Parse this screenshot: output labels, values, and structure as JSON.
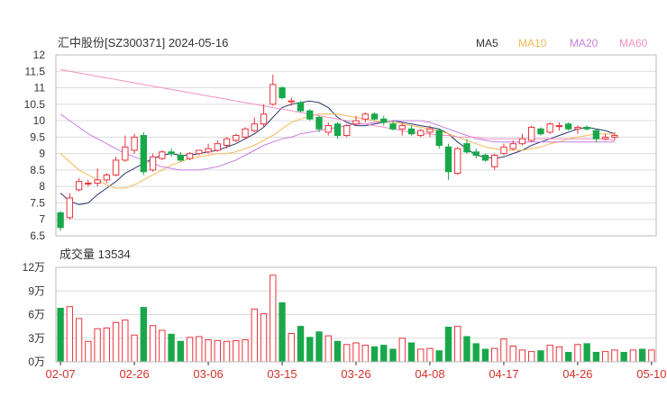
{
  "header": {
    "title": "汇中股份[SZ300371] 2024-05-16",
    "volume_label": "成交量 13534"
  },
  "legend": [
    {
      "name": "MA5",
      "color": "#2a3a6e"
    },
    {
      "name": "MA10",
      "color": "#f5b955"
    },
    {
      "name": "MA20",
      "color": "#c77fe0"
    },
    {
      "name": "MA60",
      "color": "#f490c0"
    }
  ],
  "colors": {
    "up": "#e8343c",
    "down": "#18a84a",
    "grid": "#dcdcdc",
    "axis": "#333333",
    "xtick": "#d4322c"
  },
  "chart_data": [
    {
      "type": "candlestick",
      "title": "汇中股份[SZ300371] 2024-05-16",
      "ylim": [
        6.5,
        12
      ],
      "yticks": [
        6.5,
        7,
        7.5,
        8,
        8.5,
        9,
        9.5,
        10,
        10.5,
        11,
        11.5,
        12
      ],
      "ytick_labels": [
        "6.5",
        "7",
        "7.5",
        "8",
        "8.5",
        "9",
        "9.5",
        "10",
        "10.5",
        "11",
        "11.5",
        "12"
      ],
      "x": [
        "02-07",
        "02-08",
        "02-19",
        "02-20",
        "02-21",
        "02-22",
        "02-23",
        "02-26",
        "02-27",
        "02-28",
        "02-29",
        "03-01",
        "03-04",
        "03-05",
        "03-06",
        "03-07",
        "03-08",
        "03-11",
        "03-12",
        "03-13",
        "03-14",
        "03-15",
        "03-18",
        "03-19",
        "03-20",
        "03-21",
        "03-22",
        "03-25",
        "03-26",
        "03-27",
        "03-28",
        "03-29",
        "04-01",
        "04-02",
        "04-03",
        "04-08",
        "04-09",
        "04-10",
        "04-11",
        "04-12",
        "04-15",
        "04-16",
        "04-17",
        "04-18",
        "04-19",
        "04-22",
        "04-23",
        "04-24",
        "04-25",
        "04-26",
        "04-29",
        "04-30",
        "05-06",
        "05-07",
        "05-08",
        "05-09",
        "05-10",
        "05-13",
        "05-14",
        "05-15",
        "05-16"
      ],
      "xtick_labels": [
        {
          "index": 0,
          "label": "02-07"
        },
        {
          "index": 8,
          "label": "02-26"
        },
        {
          "index": 16,
          "label": "03-06"
        },
        {
          "index": 24,
          "label": "03-15"
        },
        {
          "index": 32,
          "label": "03-26"
        },
        {
          "index": 40,
          "label": "04-08"
        },
        {
          "index": 48,
          "label": "04-17"
        },
        {
          "index": 56,
          "label": "04-26"
        },
        {
          "index": 64,
          "label": "05-10"
        }
      ],
      "ohlc": [
        [
          7.2,
          7.25,
          6.65,
          6.75
        ],
        [
          7.05,
          7.8,
          7.0,
          7.65
        ],
        [
          7.9,
          8.25,
          7.85,
          8.15
        ],
        [
          8.1,
          8.2,
          8.0,
          8.1
        ],
        [
          8.1,
          8.55,
          8.0,
          8.2
        ],
        [
          8.2,
          8.4,
          8.1,
          8.35
        ],
        [
          8.35,
          8.9,
          8.3,
          8.8
        ],
        [
          8.8,
          9.55,
          8.75,
          9.2
        ],
        [
          9.1,
          9.6,
          9.0,
          9.5
        ],
        [
          9.55,
          9.65,
          8.35,
          8.45
        ],
        [
          8.5,
          9.0,
          8.45,
          8.9
        ],
        [
          8.85,
          9.1,
          8.8,
          9.05
        ],
        [
          9.05,
          9.15,
          8.9,
          9.0
        ],
        [
          8.95,
          9.05,
          8.75,
          8.8
        ],
        [
          8.85,
          9.05,
          8.8,
          9.0
        ],
        [
          9.0,
          9.1,
          8.95,
          9.1
        ],
        [
          9.05,
          9.3,
          9.0,
          9.15
        ],
        [
          9.1,
          9.4,
          9.05,
          9.3
        ],
        [
          9.25,
          9.5,
          9.15,
          9.45
        ],
        [
          9.4,
          9.6,
          9.35,
          9.55
        ],
        [
          9.5,
          9.8,
          9.45,
          9.75
        ],
        [
          9.7,
          10.1,
          9.65,
          9.9
        ],
        [
          9.9,
          10.5,
          9.8,
          10.2
        ],
        [
          10.5,
          11.4,
          10.45,
          11.1
        ],
        [
          11.0,
          11.05,
          10.65,
          10.7
        ],
        [
          10.6,
          10.7,
          10.45,
          10.6
        ],
        [
          10.55,
          10.6,
          10.25,
          10.3
        ],
        [
          10.3,
          10.35,
          10.0,
          10.05
        ],
        [
          10.1,
          10.15,
          9.65,
          9.75
        ],
        [
          9.65,
          9.95,
          9.55,
          9.85
        ],
        [
          9.9,
          9.95,
          9.45,
          9.55
        ],
        [
          9.55,
          9.9,
          9.5,
          9.85
        ],
        [
          9.9,
          10.15,
          9.85,
          10.0
        ],
        [
          10.05,
          10.25,
          9.95,
          10.2
        ],
        [
          10.2,
          10.25,
          10.0,
          10.05
        ],
        [
          10.05,
          10.15,
          9.85,
          9.95
        ],
        [
          9.9,
          10.0,
          9.7,
          9.75
        ],
        [
          9.75,
          9.95,
          9.55,
          9.85
        ],
        [
          9.75,
          9.85,
          9.55,
          9.6
        ],
        [
          9.55,
          9.75,
          9.5,
          9.7
        ],
        [
          9.65,
          9.85,
          9.5,
          9.75
        ],
        [
          9.7,
          9.75,
          9.15,
          9.25
        ],
        [
          9.2,
          9.3,
          8.2,
          8.45
        ],
        [
          8.4,
          9.2,
          8.35,
          9.15
        ],
        [
          9.3,
          9.45,
          9.0,
          9.05
        ],
        [
          9.05,
          9.15,
          8.85,
          8.95
        ],
        [
          8.95,
          9.0,
          8.75,
          8.8
        ],
        [
          8.6,
          9.0,
          8.5,
          8.95
        ],
        [
          9.0,
          9.3,
          8.95,
          9.2
        ],
        [
          9.15,
          9.4,
          9.1,
          9.3
        ],
        [
          9.3,
          9.6,
          9.25,
          9.45
        ],
        [
          9.4,
          9.85,
          9.35,
          9.8
        ],
        [
          9.75,
          9.8,
          9.55,
          9.6
        ],
        [
          9.65,
          9.95,
          9.6,
          9.9
        ],
        [
          9.85,
          9.95,
          9.7,
          9.85
        ],
        [
          9.9,
          9.95,
          9.7,
          9.75
        ],
        [
          9.75,
          9.85,
          9.6,
          9.8
        ],
        [
          9.8,
          9.85,
          9.7,
          9.75
        ],
        [
          9.7,
          9.75,
          9.35,
          9.45
        ],
        [
          9.45,
          9.6,
          9.4,
          9.5
        ],
        [
          9.5,
          9.65,
          9.4,
          9.55
        ]
      ],
      "series": [
        {
          "name": "MA5",
          "values": [
            7.8,
            7.55,
            7.45,
            7.5,
            7.75,
            7.95,
            8.15,
            8.4,
            8.55,
            8.7,
            8.85,
            8.95,
            9.0,
            8.95,
            8.95,
            9.0,
            9.05,
            9.1,
            9.2,
            9.3,
            9.45,
            9.6,
            9.8,
            10.1,
            10.4,
            10.5,
            10.55,
            10.6,
            10.55,
            10.4,
            10.1,
            9.95,
            9.85,
            9.85,
            9.9,
            9.95,
            10.0,
            9.95,
            9.9,
            9.85,
            9.8,
            9.75,
            9.6,
            9.35,
            9.15,
            8.95,
            8.9,
            8.85,
            8.9,
            9.0,
            9.1,
            9.25,
            9.35,
            9.45,
            9.55,
            9.65,
            9.75,
            9.8,
            9.75,
            9.7,
            9.6
          ]
        },
        {
          "name": "MA10",
          "values": [
            9.0,
            8.75,
            8.5,
            8.35,
            8.2,
            8.05,
            7.95,
            7.95,
            8.05,
            8.2,
            8.35,
            8.5,
            8.65,
            8.75,
            8.85,
            8.9,
            8.95,
            9.0,
            9.0,
            9.05,
            9.15,
            9.25,
            9.4,
            9.55,
            9.75,
            9.95,
            10.05,
            10.15,
            10.2,
            10.2,
            10.2,
            10.15,
            10.1,
            10.05,
            10.0,
            9.95,
            9.95,
            9.9,
            9.85,
            9.8,
            9.75,
            9.7,
            9.6,
            9.5,
            9.4,
            9.3,
            9.2,
            9.15,
            9.1,
            9.1,
            9.1,
            9.15,
            9.2,
            9.3,
            9.35,
            9.45,
            9.5,
            9.55,
            9.6,
            9.6,
            9.6
          ]
        },
        {
          "name": "MA20",
          "values": [
            10.2,
            10.0,
            9.8,
            9.6,
            9.45,
            9.3,
            9.15,
            9.0,
            8.9,
            8.8,
            8.7,
            8.6,
            8.55,
            8.5,
            8.5,
            8.5,
            8.55,
            8.6,
            8.7,
            8.8,
            8.95,
            9.1,
            9.25,
            9.35,
            9.45,
            9.5,
            9.6,
            9.65,
            9.7,
            9.75,
            9.8,
            9.85,
            9.9,
            9.9,
            9.95,
            9.95,
            10.0,
            10.0,
            10.0,
            10.0,
            9.95,
            9.85,
            9.75,
            9.65,
            9.55,
            9.45,
            9.4,
            9.35,
            9.35,
            9.35,
            9.35,
            9.35,
            9.35,
            9.35,
            9.35,
            9.35,
            9.35,
            9.35,
            9.35,
            9.35,
            9.35
          ]
        },
        {
          "name": "MA60",
          "values": [
            11.55,
            11.5,
            11.45,
            11.4,
            11.35,
            11.3,
            11.25,
            11.2,
            11.15,
            11.1,
            11.05,
            11.0,
            10.95,
            10.9,
            10.85,
            10.8,
            10.75,
            10.7,
            10.65,
            10.6,
            10.55,
            10.5,
            10.45,
            10.4,
            10.35,
            10.3,
            10.25,
            10.2,
            10.15,
            10.1,
            10.05,
            10.0,
            9.95,
            9.9,
            9.85,
            9.8,
            9.75,
            9.7,
            9.65,
            9.6,
            9.6,
            9.55,
            9.55,
            9.5,
            9.5,
            9.5,
            9.45,
            9.45,
            9.45,
            9.45,
            9.45,
            9.45,
            9.45,
            9.45,
            9.45,
            9.45,
            9.45,
            9.45,
            9.45,
            9.45,
            9.4
          ]
        }
      ]
    },
    {
      "type": "bar",
      "title": "成交量 13534",
      "ylim": [
        0,
        12
      ],
      "yticks": [
        0,
        3,
        6,
        9,
        12
      ],
      "ytick_labels": [
        "0万",
        "3万",
        "6万",
        "9万",
        "12万"
      ],
      "values": [
        6.8,
        7.0,
        5.5,
        2.6,
        4.2,
        4.3,
        5.0,
        5.3,
        3.4,
        6.9,
        4.6,
        4.0,
        3.5,
        2.6,
        3.1,
        3.2,
        2.8,
        2.7,
        2.6,
        2.7,
        2.8,
        6.7,
        6.1,
        11.0,
        7.5,
        3.6,
        4.5,
        3.1,
        3.8,
        3.3,
        2.6,
        2.2,
        2.4,
        2.1,
        1.9,
        2.1,
        1.6,
        3.0,
        2.4,
        1.6,
        1.7,
        1.4,
        4.4,
        4.5,
        3.2,
        2.3,
        1.6,
        1.7,
        2.9,
        2.0,
        1.5,
        1.3,
        1.4,
        2.1,
        1.9,
        1.2,
        2.2,
        2.3,
        1.2,
        1.3,
        1.5,
        1.2,
        1.5,
        1.6,
        1.5
      ]
    }
  ]
}
